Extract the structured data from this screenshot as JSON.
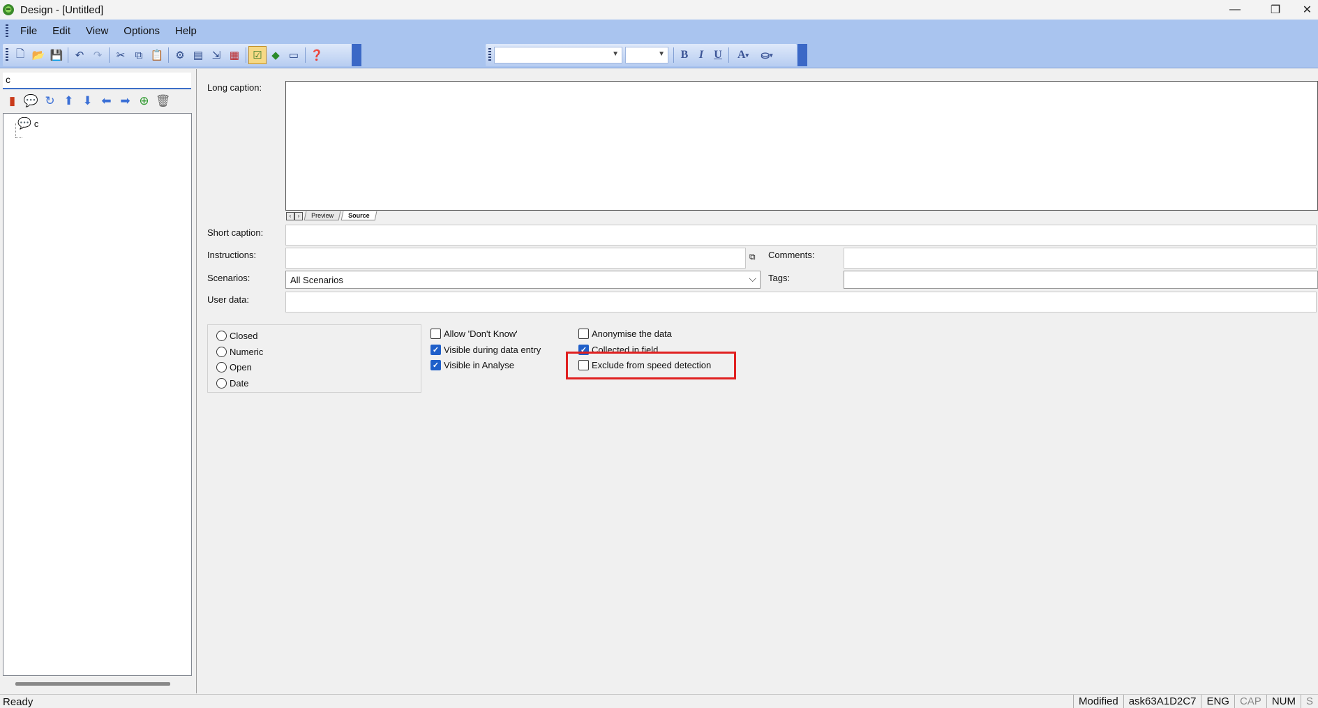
{
  "window": {
    "title": "Design - [Untitled]"
  },
  "menu": [
    "File",
    "Edit",
    "View",
    "Options",
    "Help"
  ],
  "toolbar_icons": [
    "new-icon",
    "open-icon",
    "save-icon",
    "undo-icon",
    "redo-icon",
    "cut-icon",
    "copy-icon",
    "paste-icon",
    "settings-icon",
    "page-icon",
    "import-icon",
    "table-icon",
    "validate-icon",
    "run-icon",
    "screen-icon",
    "help-icon"
  ],
  "format_toolbar": {
    "font_value": "",
    "size_value": "",
    "bold": "B",
    "italic": "I",
    "underline": "U",
    "font_color": "A"
  },
  "left": {
    "search_value": "c",
    "tree_node_label": "c"
  },
  "fields": {
    "long_caption_label": "Long caption:",
    "tab_preview": "Preview",
    "tab_source": "Source",
    "short_caption_label": "Short caption:",
    "instructions_label": "Instructions:",
    "comments_label": "Comments:",
    "scenarios_label": "Scenarios:",
    "scenarios_value": "All Scenarios",
    "tags_label": "Tags:",
    "user_data_label": "User data:"
  },
  "types": [
    "Closed",
    "Numeric",
    "Open",
    "Date"
  ],
  "options_col1": [
    {
      "label": "Allow 'Don't Know'",
      "checked": false
    },
    {
      "label": "Visible during data entry",
      "checked": true
    },
    {
      "label": "Visible in Analyse",
      "checked": true
    }
  ],
  "options_col2": [
    {
      "label": "Anonymise the data",
      "checked": false
    },
    {
      "label": "Collected in field",
      "checked": true
    },
    {
      "label": "Exclude from speed detection",
      "checked": false
    }
  ],
  "status": {
    "ready": "Ready",
    "modified": "Modified",
    "id": "ask63A1D2C7",
    "lang": "ENG",
    "cap": "CAP",
    "num": "NUM",
    "scrl": "S"
  }
}
